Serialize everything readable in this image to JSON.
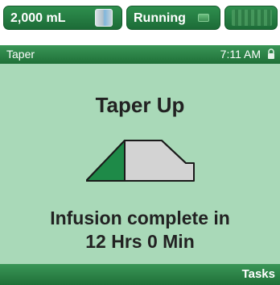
{
  "status_bar": {
    "volume": "2,000 mL",
    "status": "Running"
  },
  "header": {
    "title": "Taper",
    "time": "7:11 AM"
  },
  "main": {
    "heading": "Taper Up",
    "message_line1": "Infusion complete in",
    "message_line2": "12 Hrs 0 Min",
    "taper_progress_fraction": 0.3
  },
  "footer": {
    "tasks_label": "Tasks"
  },
  "colors": {
    "brand_green": "#1f7038",
    "background_green": "#a9d9b8",
    "taper_fill_green": "#1e8a48",
    "taper_remaining_gray": "#d3d3d3"
  },
  "icons": [
    "fluid-bag-icon",
    "run-indicator-icon",
    "lock-icon",
    "taper-ramp-icon"
  ]
}
